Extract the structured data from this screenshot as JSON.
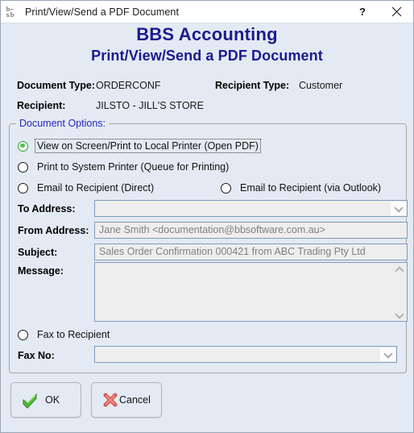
{
  "window": {
    "title": "Print/View/Send a PDF Document",
    "icon": "bbs-logo-icon",
    "help_label": "?",
    "close_label": "✕"
  },
  "heading": {
    "line1": "BBS Accounting",
    "line2": "Print/View/Send a PDF Document",
    "color": "#1b1b8f"
  },
  "info": {
    "document_type_label": "Document Type:",
    "document_type_value": "ORDERCONF",
    "recipient_type_label": "Recipient Type:",
    "recipient_type_value": "Customer",
    "recipient_label": "Recipient:",
    "recipient_value": "JILSTO - JILL'S STORE"
  },
  "options": {
    "group_title": "Document Options:",
    "radios": [
      {
        "label": "View on Screen/Print to Local Printer (Open PDF)",
        "checked": true,
        "focused": true
      },
      {
        "label": "Print to System Printer (Queue for Printing)",
        "checked": false,
        "focused": false
      },
      {
        "label": "Email to Recipient (Direct)",
        "checked": false,
        "focused": false
      },
      {
        "label": "Email to Recipient (via Outlook)",
        "checked": false,
        "focused": false
      },
      {
        "label": "Fax to Recipient",
        "checked": false,
        "focused": false
      }
    ]
  },
  "fields": {
    "to_address_label": "To Address:",
    "to_address_value": "",
    "from_address_label": "From Address:",
    "from_address_value": "Jane Smith <documentation@bbsoftware.com.au>",
    "subject_label": "Subject:",
    "subject_value": "Sales Order Confirmation 000421 from ABC Trading Pty Ltd",
    "message_label": "Message:",
    "message_value": "",
    "fax_no_label": "Fax No:",
    "fax_no_value": ""
  },
  "buttons": {
    "ok_label": "OK",
    "ok_icon": "green-check-icon",
    "cancel_label": "Cancel",
    "cancel_icon": "red-cross-icon"
  }
}
